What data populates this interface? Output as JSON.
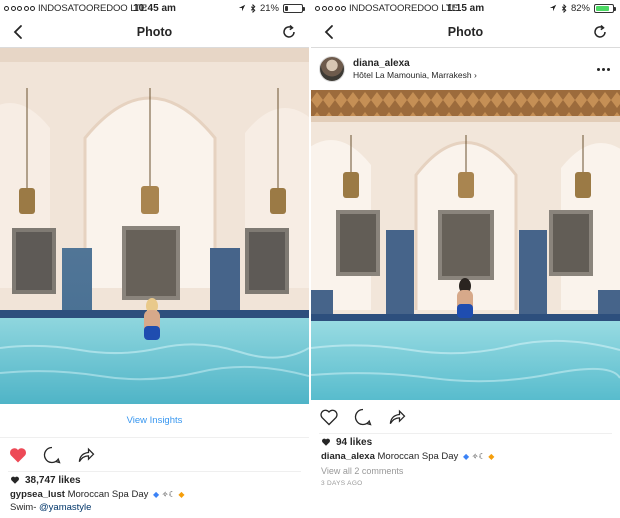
{
  "left": {
    "status": {
      "carrier": "INDOSATOOREDOO",
      "network": "LTE",
      "time": "10:45 am",
      "battery_text": "21%",
      "battery_level": 0.21
    },
    "nav": {
      "title": "Photo"
    },
    "insights_label": "View Insights",
    "likes": "38,747 likes",
    "caption": {
      "username": "gypsea_lust",
      "text": "Moroccan Spa Day"
    },
    "caption_line2": {
      "text": "Swim- ",
      "mention": "@yamastyle"
    }
  },
  "right": {
    "status": {
      "carrier": "INDOSATOOREDOO",
      "network": "LTE",
      "time": "1:15 am",
      "battery_text": "82%",
      "battery_level": 0.82
    },
    "nav": {
      "title": "Photo"
    },
    "post": {
      "username": "diana_alexa",
      "location": "Hôtel La Mamounia, Marrakesh"
    },
    "likes": "94 likes",
    "caption": {
      "username": "diana_alexa",
      "text": "Moroccan Spa Day"
    },
    "comments_link": "View all 2 comments",
    "date": "3 DAYS AGO"
  },
  "icons": [
    "back-chevron-icon",
    "refresh-icon",
    "heart-icon",
    "comment-icon",
    "share-icon",
    "more-icon",
    "location-icon",
    "gps-arrow-icon"
  ],
  "colors": {
    "like_red": "#ed4956",
    "link_blue": "#3897f0",
    "pool": "#6fc9d6",
    "wall": "#f1e4d8"
  }
}
